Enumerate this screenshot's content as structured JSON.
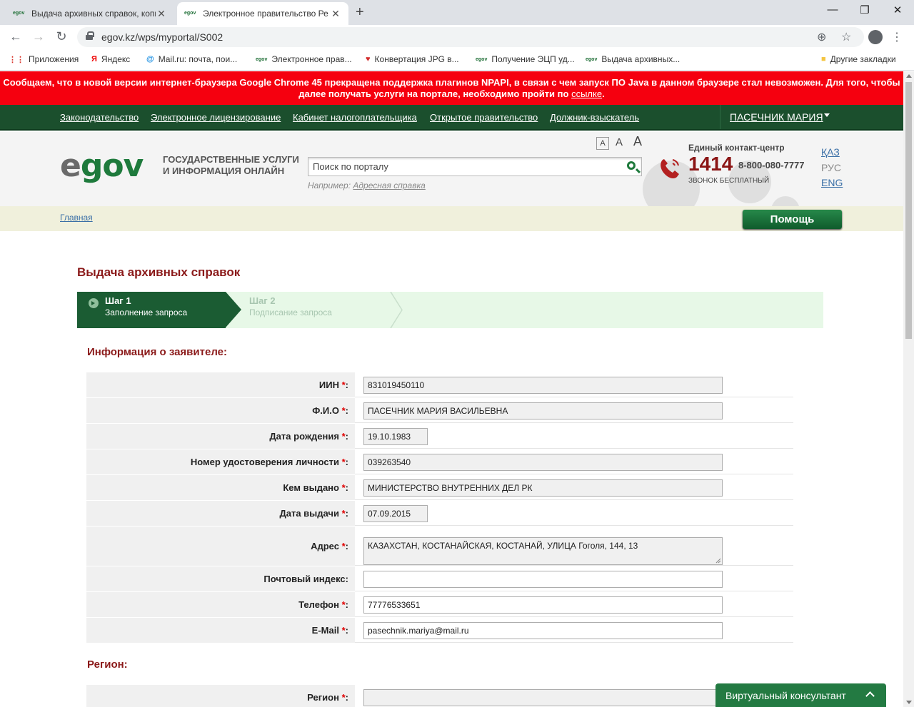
{
  "browser": {
    "tabs": [
      {
        "favicon": "egov",
        "title": "Выдача архивных справок, копи",
        "active": false
      },
      {
        "favicon": "egov",
        "title": "Электронное правительство Ре",
        "active": true
      }
    ],
    "new_tab": "+",
    "address": "egov.kz/wps/myportal/S002",
    "window_controls": {
      "minimize": "—",
      "restore": "❐",
      "close": "✕"
    },
    "bookmarks": [
      {
        "icon": "apps-grid-icon",
        "glyph": "⋮⋮",
        "label": "Приложения"
      },
      {
        "icon": "yandex-icon",
        "glyph": "Я",
        "label": "Яндекс"
      },
      {
        "icon": "mailru-icon",
        "glyph": "@",
        "label": "Mail.ru: почта, пои..."
      },
      {
        "icon": "egov-icon",
        "glyph": "egov",
        "label": "Электронное прав..."
      },
      {
        "icon": "heart-icon",
        "glyph": "♥",
        "label": "Конвертация JPG в..."
      },
      {
        "icon": "egov-icon",
        "glyph": "egov",
        "label": "Получение ЭЦП уд..."
      },
      {
        "icon": "egov-icon",
        "glyph": "egov",
        "label": "Выдача архивных..."
      },
      {
        "icon": "folder-icon",
        "glyph": "■",
        "label": "Другие закладки"
      }
    ]
  },
  "alert": {
    "text": "Сообщаем, что в новой версии интернет-браузера Google Chrome 45 прекращена поддержка плагинов NPAPI, в связи с чем запуск ПО Java в данном браузере стал невозможен. Для того, чтобы далее получать услуги на портале, необходимо пройти по ",
    "link": "ссылке",
    "tail": "."
  },
  "topnav": {
    "links": [
      "Законодательство",
      "Электронное лицензирование",
      "Кабинет налогоплательщика",
      "Открытое правительство",
      "Должник-взыскатель"
    ],
    "user": "ПАСЕЧНИК МАРИЯ"
  },
  "header": {
    "logo_e": "e",
    "logo_rest": "gov",
    "tagline1": "ГОСУДАРСТВЕННЫЕ УСЛУГИ",
    "tagline2": "И ИНФОРМАЦИЯ ОНЛАЙН",
    "search_placeholder": "Поиск по порталу",
    "example_prefix": "Например: ",
    "example_link": "Адресная справка",
    "font_sizes": [
      "A",
      "A",
      "A"
    ],
    "contact_title": "Единый контакт-центр",
    "contact_number": "1414",
    "contact_alt": "8-800-080-7777",
    "contact_free": "ЗВОНОК БЕСПЛАТНЫЙ",
    "languages": [
      "ҚАЗ",
      "РУС",
      "ENG"
    ]
  },
  "breadcrumb": {
    "home": "Главная",
    "help": "Помощь"
  },
  "page_title": "Выдача архивных справок",
  "steps": [
    {
      "title": "Шаг 1",
      "subtitle": "Заполнение запроса",
      "active": true
    },
    {
      "title": "Шаг 2",
      "subtitle": "Подписание запроса",
      "active": false
    }
  ],
  "applicant_section": "Информация о заявителе:",
  "form": {
    "required_mark": "*",
    "fields": [
      {
        "label": "ИИН",
        "required": true,
        "value": "831019450110"
      },
      {
        "label": "Ф.И.О",
        "required": true,
        "value": "ПАСЕЧНИК МАРИЯ ВАСИЛЬЕВНА"
      },
      {
        "label": "Дата рождения",
        "required": true,
        "value": "19.10.1983"
      },
      {
        "label": "Номер удостоверения личности",
        "required": true,
        "value": "039263540"
      },
      {
        "label": "Кем выдано",
        "required": true,
        "value": "МИНИСТЕРСТВО ВНУТРЕННИХ ДЕЛ РК"
      },
      {
        "label": "Дата выдачи",
        "required": true,
        "value": "07.09.2015"
      },
      {
        "label": "Адрес",
        "required": true,
        "value": "КАЗАХСТАН, КОСТАНАЙСКАЯ, КОСТАНАЙ, УЛИЦА Гоголя, 144, 13"
      },
      {
        "label": "Почтовый индекс",
        "required": false,
        "value": ""
      },
      {
        "label": "Телефон",
        "required": true,
        "value": "77776533651"
      },
      {
        "label": "E-Mail",
        "required": true,
        "value": "pasechnik.mariya@mail.ru"
      }
    ]
  },
  "region_section": "Регион:",
  "region_field": {
    "label": "Регион",
    "required": true,
    "value": ""
  },
  "consultant": "Виртуальный консультант"
}
